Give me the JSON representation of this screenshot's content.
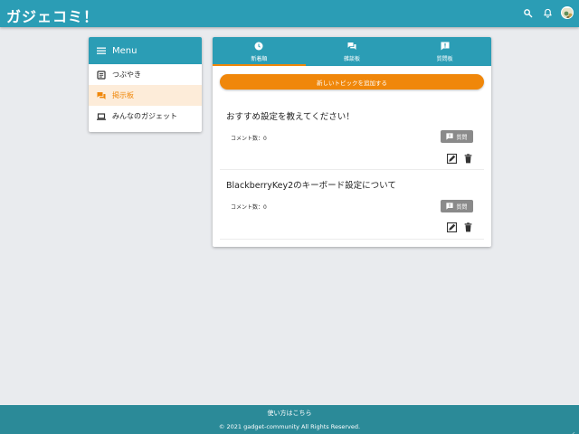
{
  "app": {
    "title": "ガジェコミ！"
  },
  "colors": {
    "primary": "#2b9db5",
    "accent": "#f0870a",
    "badge": "#8a8a8a",
    "footer": "#2b8a98"
  },
  "header": {
    "icons": [
      "search-icon",
      "bell-icon",
      "avatar"
    ]
  },
  "sidebar": {
    "title": "Menu",
    "items": [
      {
        "label": "つぶやき",
        "icon": "note-icon",
        "active": false
      },
      {
        "label": "掲示板",
        "icon": "forum-icon",
        "active": true
      },
      {
        "label": "みんなのガジェット",
        "icon": "laptop-icon",
        "active": false
      }
    ]
  },
  "tabs": [
    {
      "label": "新着順",
      "icon": "clock-icon",
      "active": true
    },
    {
      "label": "雑談板",
      "icon": "forum-icon",
      "active": false
    },
    {
      "label": "質問板",
      "icon": "question-chat-icon",
      "active": false
    }
  ],
  "add_button": "新しいトピックを追加する",
  "topics": [
    {
      "title": "おすすめ設定を教えてください！",
      "comment_label": "コメント数：",
      "comment_count": "0",
      "badge": "質問"
    },
    {
      "title": "BlackberryKey2のキーボード設定について",
      "comment_label": "コメント数：",
      "comment_count": "0",
      "badge": "質問"
    }
  ],
  "footer": {
    "link": "使い方はこちら",
    "copyright": "© 2021 gadget-community All Rights Reserved."
  }
}
